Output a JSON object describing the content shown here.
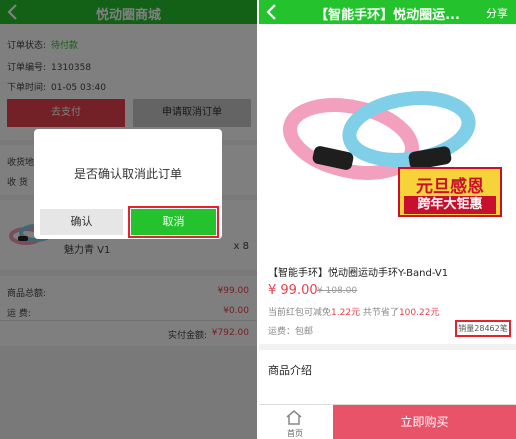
{
  "left": {
    "header_title": "悦动圈商城",
    "order": {
      "status_label": "订单状态:",
      "status_value": "待付款",
      "number_label": "订单编号:",
      "number_value": "1310358",
      "time_label": "下单时间:",
      "time_value": "01-05 03:40"
    },
    "pay_button": "去支付",
    "cancel_request_button": "申请取消订单",
    "receiver_label_1": "收货地址",
    "receiver_label_2": "收    货",
    "product_name": "魅力青 V1",
    "product_qty": "x 8",
    "totals": {
      "goods_label": "商品总额:",
      "goods_value": "¥99.00",
      "ship_label": "运       费:",
      "ship_value": "¥0.00",
      "paid_label": "实付金额:",
      "paid_value": "¥792.00"
    },
    "dialog": {
      "message": "是否确认取消此订单",
      "confirm": "确认",
      "cancel": "取消"
    }
  },
  "right": {
    "header_title": "【智能手环】悦动圈运...",
    "share": "分享",
    "promo_line1": "元旦感恩",
    "promo_line2": "跨年大钜惠",
    "product_title": "【智能手环】悦动圈运动手环Y-Band-V1",
    "price": "¥ 99.00",
    "old_price": "¥ 108.00",
    "promo_prefix": "当前红包可减免",
    "promo_amount": "1.22元",
    "promo_mid": "  共节省了",
    "promo_saved": "100.22元",
    "shipping": "运费：包邮",
    "sales": "销量28462笔",
    "intro_title": "商品介绍",
    "home_label": "首页",
    "buy_button": "立即购买"
  },
  "colors": {
    "green": "#24c32e",
    "red": "#e8414e",
    "highlight": "#e8212e"
  },
  "icons": [
    "back-icon",
    "home-icon"
  ]
}
